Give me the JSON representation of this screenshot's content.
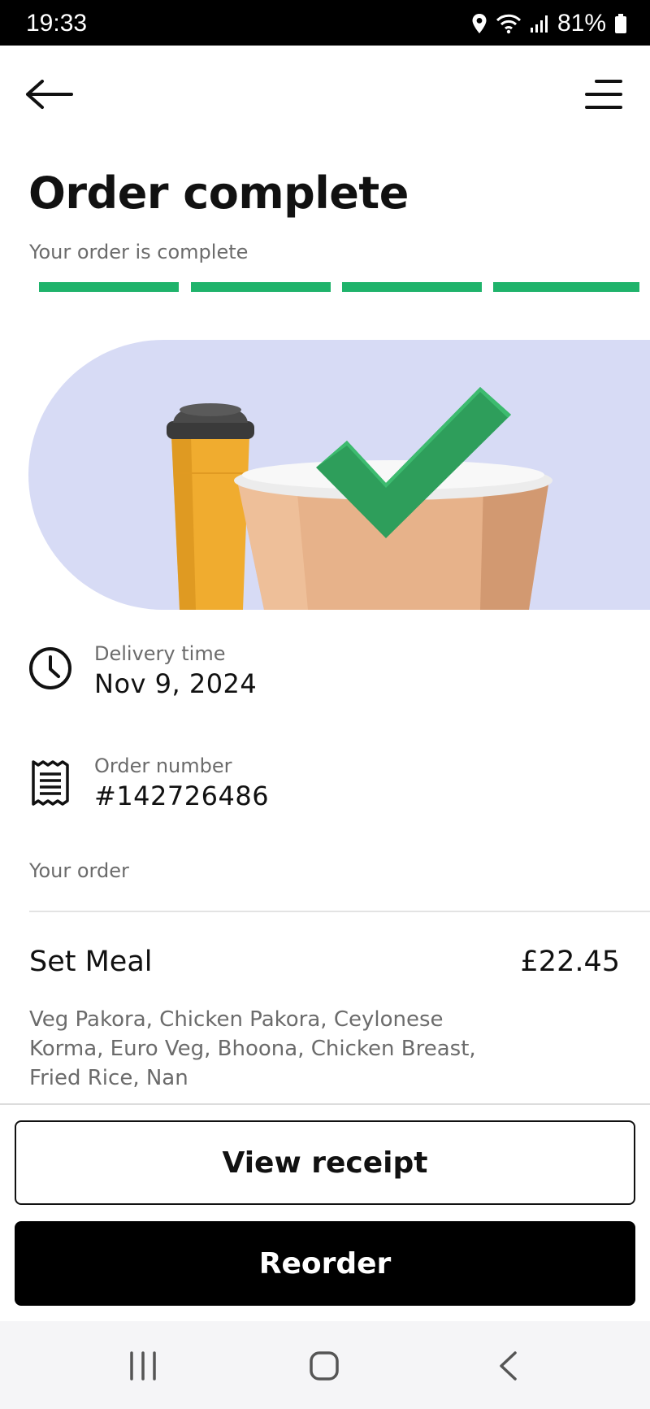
{
  "status_bar": {
    "time": "19:33",
    "battery": "81%"
  },
  "header": {
    "title": "Order complete",
    "subtitle": "Your order is complete"
  },
  "progress": {
    "steps_total": 4,
    "steps_completed": 4
  },
  "delivery": {
    "label": "Delivery time",
    "value": "Nov 9, 2024"
  },
  "order_number": {
    "label": "Order number",
    "value": "#142726486"
  },
  "order_section": {
    "label": "Your order",
    "items": [
      {
        "name": "Set Meal",
        "price": "£22.45",
        "description": "Veg Pakora, Chicken Pakora, Ceylonese Korma, Euro Veg, Bhoona, Chicken Breast, Fried Rice, Nan"
      }
    ]
  },
  "actions": {
    "view_receipt_label": "View receipt",
    "reorder_label": "Reorder"
  },
  "colors": {
    "accent_green": "#1fb36b",
    "hero_bg": "#d7dbf5",
    "button_dark": "#000000"
  },
  "icons": [
    "location-icon",
    "wifi-icon",
    "signal-icon",
    "battery-icon",
    "back-arrow-icon",
    "menu-icon",
    "clock-icon",
    "receipt-icon",
    "recent-apps-icon",
    "home-icon",
    "back-nav-icon"
  ]
}
